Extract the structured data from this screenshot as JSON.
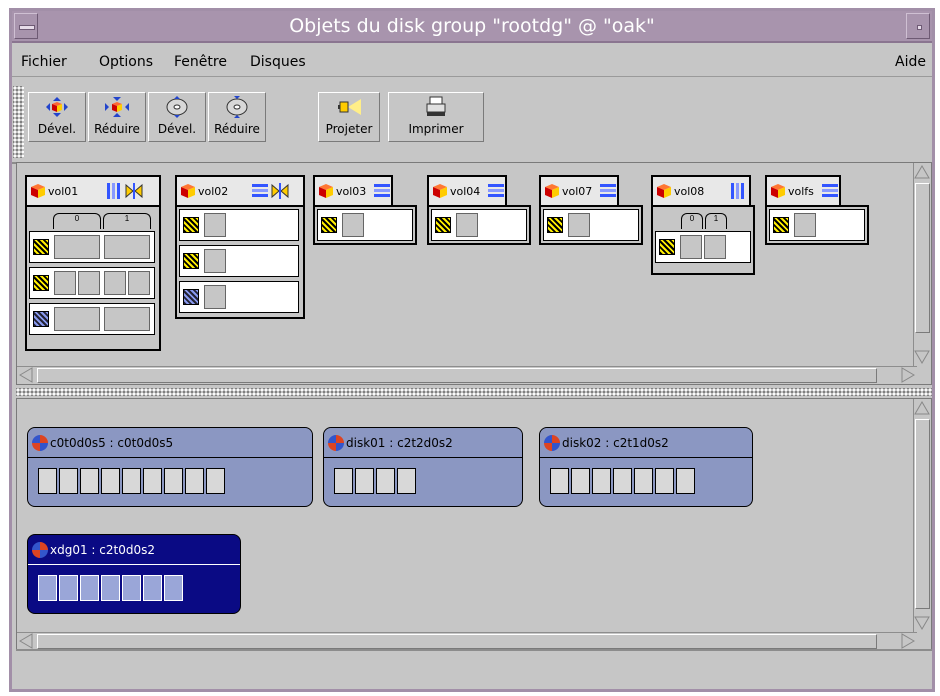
{
  "window": {
    "title": "Objets du disk group \"rootdg\" @ \"oak\""
  },
  "menubar": {
    "items": [
      "Fichier",
      "Options",
      "Fenêtre",
      "Disques"
    ],
    "help": "Aide"
  },
  "toolbar": {
    "buttons": [
      {
        "label": "Dével.",
        "icon": "expand-volume-icon"
      },
      {
        "label": "Réduire",
        "icon": "collapse-volume-icon"
      },
      {
        "label": "Dével.",
        "icon": "expand-disk-icon"
      },
      {
        "label": "Réduire",
        "icon": "collapse-disk-icon"
      },
      {
        "label": "Projeter",
        "icon": "project-icon"
      },
      {
        "label": "Imprimer",
        "icon": "printer-icon"
      }
    ]
  },
  "volumes": [
    {
      "name": "vol01",
      "columns": [
        "0",
        "1"
      ]
    },
    {
      "name": "vol02"
    },
    {
      "name": "vol03"
    },
    {
      "name": "vol04"
    },
    {
      "name": "vol07"
    },
    {
      "name": "vol08",
      "columns": [
        "0",
        "1"
      ]
    },
    {
      "name": "volfs"
    }
  ],
  "disks": [
    {
      "name": "c0t0d0s5 : c0t0d0s5",
      "cells": 9,
      "selected": false
    },
    {
      "name": "disk01 : c2t2d0s2",
      "cells": 4,
      "selected": false
    },
    {
      "name": "disk02 : c2t1d0s2",
      "cells": 7,
      "selected": false
    },
    {
      "name": "xdg01 : c2t0d0s2",
      "cells": 7,
      "selected": true
    }
  ],
  "colors": {
    "title_bar": "#a894ad",
    "disk_fill": "#8b97c2",
    "disk_selected": "#0a0a84",
    "background": "#c6c6c6"
  }
}
